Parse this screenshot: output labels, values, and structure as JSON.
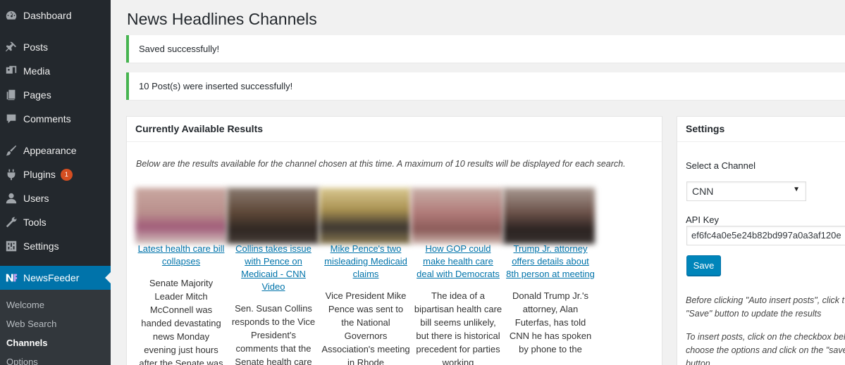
{
  "sidebar": {
    "items": [
      {
        "label": "Dashboard",
        "icon": "dashboard-icon"
      },
      {
        "label": "Posts",
        "icon": "pin-icon"
      },
      {
        "label": "Media",
        "icon": "media-icon"
      },
      {
        "label": "Pages",
        "icon": "pages-icon"
      },
      {
        "label": "Comments",
        "icon": "comment-icon"
      },
      {
        "label": "Appearance",
        "icon": "brush-icon"
      },
      {
        "label": "Plugins",
        "icon": "plugin-icon",
        "badge": "1"
      },
      {
        "label": "Users",
        "icon": "users-icon"
      },
      {
        "label": "Tools",
        "icon": "wrench-icon"
      },
      {
        "label": "Settings",
        "icon": "settings-icon"
      },
      {
        "label": "NewsFeeder",
        "icon": "newsfeeder-logo-icon"
      }
    ],
    "submenu": [
      "Welcome",
      "Web Search",
      "Channels",
      "Options"
    ]
  },
  "page": {
    "title": "News Headlines Channels"
  },
  "notices": [
    "Saved successfully!",
    "10 Post(s) were inserted successfully!"
  ],
  "results": {
    "heading": "Currently Available Results",
    "description": "Below are the results available for the channel chosen at this time. A maximum of 10 results will be displayed for each search.",
    "items": [
      {
        "title": "Latest health care bill collapses",
        "summary": "Senate Majority Leader Mitch McConnell was handed devastating news Monday evening just hours after the Senate was"
      },
      {
        "title": "Collins takes issue with Pence on Medicaid - CNN Video",
        "summary": "Sen. Susan Collins responds to the Vice President's comments that the Senate health care"
      },
      {
        "title": "Mike Pence's two misleading Medicaid claims",
        "summary": "Vice President Mike Pence was sent to the National Governors Association's meeting in Rhode"
      },
      {
        "title": "How GOP could make health care deal with Democrats",
        "summary": "The idea of a bipartisan health care bill seems unlikely, but there is historical precedent for parties working"
      },
      {
        "title": "Trump Jr. attorney offers details about 8th person at meeting",
        "summary": "Donald Trump Jr.'s attorney, Alan Futerfas, has told CNN he has spoken by phone to the"
      }
    ]
  },
  "settings": {
    "heading": "Settings",
    "channel_label": "Select a Channel",
    "channel_value": "CNN",
    "api_label": "API Key",
    "api_value": "ef6fc4a0e5e24b82bd997a0a3af120e",
    "save_label": "Save",
    "help1": "Before clicking \"Auto insert posts\", click t \"Save\" button to update the results",
    "help2": "To insert posts, click on the checkbox bel choose the options and click on the \"save button"
  },
  "colors": {
    "sidebar": "#23282d",
    "active": "#0073aa",
    "success": "#46b450",
    "link": "#0073aa"
  }
}
